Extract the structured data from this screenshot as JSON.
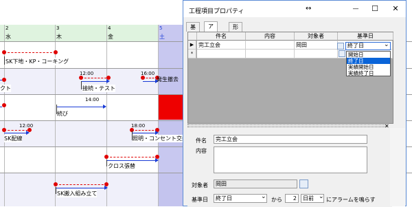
{
  "gantt": {
    "days": [
      {
        "num": "2",
        "name": "水"
      },
      {
        "num": "3",
        "name": "木"
      },
      {
        "num": "4",
        "name": "金"
      },
      {
        "num": "5",
        "name": "土"
      }
    ],
    "tasks": {
      "t1": "SK下地・KP・コーキング",
      "t2": "クト",
      "t3_time": "12:00",
      "t3": "接続・テスト",
      "t4_time": "16:00",
      "t4": "発生撤去",
      "t5_time": "14:00",
      "t5": "続び",
      "t6_time": "12:00",
      "t6": "SK配線",
      "t7_time": "18:00",
      "t7": "照明・コンセント交換",
      "t8": "クロス張替",
      "t9": "SK搬入組み立て"
    },
    "colors": {
      "header": "#dff3df",
      "weekend": "#c8c8f0",
      "red_cell": "#ee0000",
      "bar": "#e00000",
      "arrow": "#1a3cd6"
    }
  },
  "dialog": {
    "title": "工程項目プロパティ",
    "move_icon": "↔",
    "minimize": "—",
    "maximize": "☐",
    "close": "✕",
    "tabs": [
      "基本",
      "アラーム",
      "形状"
    ],
    "grid": {
      "columns": [
        "件名",
        "内容",
        "対象者",
        "基準日"
      ],
      "row1": {
        "indicator": "▶",
        "subject": "完工立会",
        "content": "",
        "person": "岡田",
        "base": "終了日"
      },
      "row2": {
        "indicator": "*"
      },
      "combo_arrow": "⌄",
      "dropdown_options": [
        "開始日",
        "終了日",
        "実績開始日",
        "実績終了日"
      ],
      "dropdown_selected": "終了日"
    },
    "detail": {
      "close": "✕",
      "subject_label": "件名",
      "subject_value": "完工立会",
      "content_label": "内容",
      "person_label": "対象者",
      "person_value": "岡田",
      "base_label": "基準日",
      "base_value": "終了日",
      "from_text": "から",
      "days_value": "2",
      "offset_value": "日前",
      "alarm_text": "にアラームを鳴らす"
    }
  }
}
